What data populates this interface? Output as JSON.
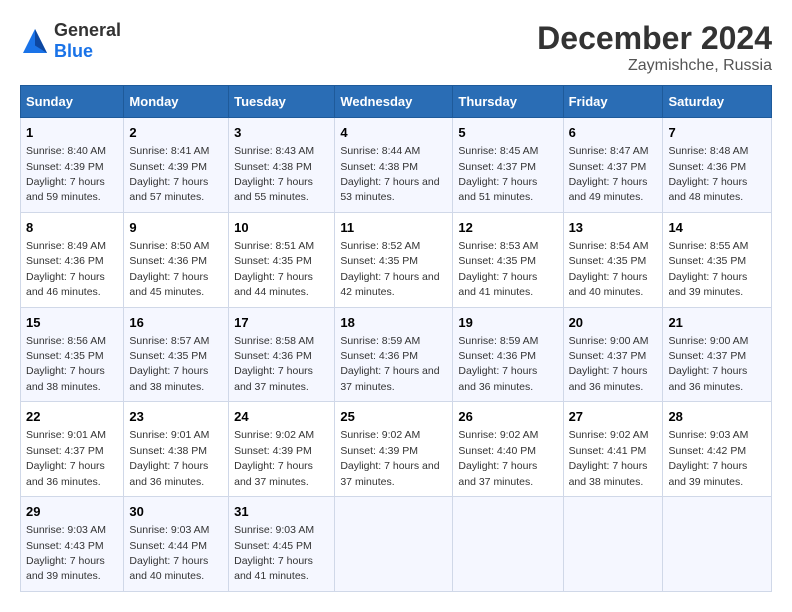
{
  "header": {
    "logo_general": "General",
    "logo_blue": "Blue",
    "title": "December 2024",
    "subtitle": "Zaymishche, Russia"
  },
  "days_of_week": [
    "Sunday",
    "Monday",
    "Tuesday",
    "Wednesday",
    "Thursday",
    "Friday",
    "Saturday"
  ],
  "weeks": [
    [
      {
        "day": "1",
        "sunrise": "Sunrise: 8:40 AM",
        "sunset": "Sunset: 4:39 PM",
        "daylight": "Daylight: 7 hours and 59 minutes."
      },
      {
        "day": "2",
        "sunrise": "Sunrise: 8:41 AM",
        "sunset": "Sunset: 4:39 PM",
        "daylight": "Daylight: 7 hours and 57 minutes."
      },
      {
        "day": "3",
        "sunrise": "Sunrise: 8:43 AM",
        "sunset": "Sunset: 4:38 PM",
        "daylight": "Daylight: 7 hours and 55 minutes."
      },
      {
        "day": "4",
        "sunrise": "Sunrise: 8:44 AM",
        "sunset": "Sunset: 4:38 PM",
        "daylight": "Daylight: 7 hours and 53 minutes."
      },
      {
        "day": "5",
        "sunrise": "Sunrise: 8:45 AM",
        "sunset": "Sunset: 4:37 PM",
        "daylight": "Daylight: 7 hours and 51 minutes."
      },
      {
        "day": "6",
        "sunrise": "Sunrise: 8:47 AM",
        "sunset": "Sunset: 4:37 PM",
        "daylight": "Daylight: 7 hours and 49 minutes."
      },
      {
        "day": "7",
        "sunrise": "Sunrise: 8:48 AM",
        "sunset": "Sunset: 4:36 PM",
        "daylight": "Daylight: 7 hours and 48 minutes."
      }
    ],
    [
      {
        "day": "8",
        "sunrise": "Sunrise: 8:49 AM",
        "sunset": "Sunset: 4:36 PM",
        "daylight": "Daylight: 7 hours and 46 minutes."
      },
      {
        "day": "9",
        "sunrise": "Sunrise: 8:50 AM",
        "sunset": "Sunset: 4:36 PM",
        "daylight": "Daylight: 7 hours and 45 minutes."
      },
      {
        "day": "10",
        "sunrise": "Sunrise: 8:51 AM",
        "sunset": "Sunset: 4:35 PM",
        "daylight": "Daylight: 7 hours and 44 minutes."
      },
      {
        "day": "11",
        "sunrise": "Sunrise: 8:52 AM",
        "sunset": "Sunset: 4:35 PM",
        "daylight": "Daylight: 7 hours and 42 minutes."
      },
      {
        "day": "12",
        "sunrise": "Sunrise: 8:53 AM",
        "sunset": "Sunset: 4:35 PM",
        "daylight": "Daylight: 7 hours and 41 minutes."
      },
      {
        "day": "13",
        "sunrise": "Sunrise: 8:54 AM",
        "sunset": "Sunset: 4:35 PM",
        "daylight": "Daylight: 7 hours and 40 minutes."
      },
      {
        "day": "14",
        "sunrise": "Sunrise: 8:55 AM",
        "sunset": "Sunset: 4:35 PM",
        "daylight": "Daylight: 7 hours and 39 minutes."
      }
    ],
    [
      {
        "day": "15",
        "sunrise": "Sunrise: 8:56 AM",
        "sunset": "Sunset: 4:35 PM",
        "daylight": "Daylight: 7 hours and 38 minutes."
      },
      {
        "day": "16",
        "sunrise": "Sunrise: 8:57 AM",
        "sunset": "Sunset: 4:35 PM",
        "daylight": "Daylight: 7 hours and 38 minutes."
      },
      {
        "day": "17",
        "sunrise": "Sunrise: 8:58 AM",
        "sunset": "Sunset: 4:36 PM",
        "daylight": "Daylight: 7 hours and 37 minutes."
      },
      {
        "day": "18",
        "sunrise": "Sunrise: 8:59 AM",
        "sunset": "Sunset: 4:36 PM",
        "daylight": "Daylight: 7 hours and 37 minutes."
      },
      {
        "day": "19",
        "sunrise": "Sunrise: 8:59 AM",
        "sunset": "Sunset: 4:36 PM",
        "daylight": "Daylight: 7 hours and 36 minutes."
      },
      {
        "day": "20",
        "sunrise": "Sunrise: 9:00 AM",
        "sunset": "Sunset: 4:37 PM",
        "daylight": "Daylight: 7 hours and 36 minutes."
      },
      {
        "day": "21",
        "sunrise": "Sunrise: 9:00 AM",
        "sunset": "Sunset: 4:37 PM",
        "daylight": "Daylight: 7 hours and 36 minutes."
      }
    ],
    [
      {
        "day": "22",
        "sunrise": "Sunrise: 9:01 AM",
        "sunset": "Sunset: 4:37 PM",
        "daylight": "Daylight: 7 hours and 36 minutes."
      },
      {
        "day": "23",
        "sunrise": "Sunrise: 9:01 AM",
        "sunset": "Sunset: 4:38 PM",
        "daylight": "Daylight: 7 hours and 36 minutes."
      },
      {
        "day": "24",
        "sunrise": "Sunrise: 9:02 AM",
        "sunset": "Sunset: 4:39 PM",
        "daylight": "Daylight: 7 hours and 37 minutes."
      },
      {
        "day": "25",
        "sunrise": "Sunrise: 9:02 AM",
        "sunset": "Sunset: 4:39 PM",
        "daylight": "Daylight: 7 hours and 37 minutes."
      },
      {
        "day": "26",
        "sunrise": "Sunrise: 9:02 AM",
        "sunset": "Sunset: 4:40 PM",
        "daylight": "Daylight: 7 hours and 37 minutes."
      },
      {
        "day": "27",
        "sunrise": "Sunrise: 9:02 AM",
        "sunset": "Sunset: 4:41 PM",
        "daylight": "Daylight: 7 hours and 38 minutes."
      },
      {
        "day": "28",
        "sunrise": "Sunrise: 9:03 AM",
        "sunset": "Sunset: 4:42 PM",
        "daylight": "Daylight: 7 hours and 39 minutes."
      }
    ],
    [
      {
        "day": "29",
        "sunrise": "Sunrise: 9:03 AM",
        "sunset": "Sunset: 4:43 PM",
        "daylight": "Daylight: 7 hours and 39 minutes."
      },
      {
        "day": "30",
        "sunrise": "Sunrise: 9:03 AM",
        "sunset": "Sunset: 4:44 PM",
        "daylight": "Daylight: 7 hours and 40 minutes."
      },
      {
        "day": "31",
        "sunrise": "Sunrise: 9:03 AM",
        "sunset": "Sunset: 4:45 PM",
        "daylight": "Daylight: 7 hours and 41 minutes."
      },
      null,
      null,
      null,
      null
    ]
  ]
}
